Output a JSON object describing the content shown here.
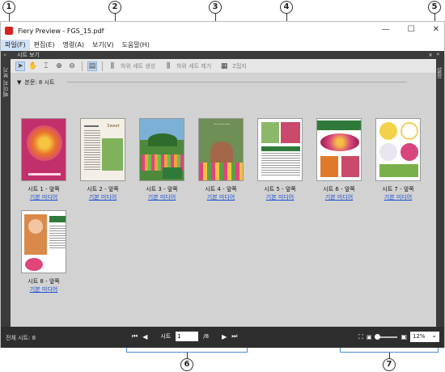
{
  "callouts": [
    "1",
    "2",
    "3",
    "4",
    "5",
    "6",
    "7"
  ],
  "window": {
    "title": "Fiery Preview - FGS_15.pdf",
    "minimize": "—",
    "maximize": "☐",
    "close": "✕"
  },
  "menu": [
    "파일(F)",
    "편집(E)",
    "명령(A)",
    "보기(V)",
    "도움말(H)"
  ],
  "panel": {
    "title": "시트 보기",
    "close": "×",
    "left_collapse": "»",
    "right_collapse": "«",
    "left_rail": "페이지 보기",
    "right_rail": "설정"
  },
  "toolbar": {
    "icons": [
      "select-arrow-icon",
      "hand-icon",
      "text-select-icon",
      "zoom-in-icon",
      "zoom-out-icon",
      "sheet-icon"
    ],
    "create_subset": "하위 세트 생성",
    "remove_subset": "하위 세트 제거",
    "merge": "Z접지"
  },
  "section": {
    "label": "본문: 8 시트"
  },
  "sheets": [
    {
      "label": "시트 1 - 앞쪽",
      "media": "기본 미디어",
      "bg": "#c2306b"
    },
    {
      "label": "시트 2 - 앞쪽",
      "media": "기본 미디어",
      "bg": "#f4efe6"
    },
    {
      "label": "시트 3 - 앞쪽",
      "media": "기본 미디어",
      "bg": "#4f8a3c"
    },
    {
      "label": "시트 4 - 앞쪽",
      "media": "기본 미디어",
      "bg": "#6e8f55"
    },
    {
      "label": "시트 5 - 앞쪽",
      "media": "기본 미디어",
      "bg": "#ffffff"
    },
    {
      "label": "시트 6 - 앞쪽",
      "media": "기본 미디어",
      "bg": "#ffffff"
    },
    {
      "label": "시트 7 - 앞쪽",
      "media": "기본 미디어",
      "bg": "#ffffff"
    },
    {
      "label": "시트 8 - 앞쪽",
      "media": "기본 미디어",
      "bg": "#ffffff"
    }
  ],
  "status": {
    "total_sheets": "전체 시트: 8",
    "sheet_label": "시트",
    "current_page": "1",
    "page_total": "/8",
    "zoom": "12%"
  }
}
